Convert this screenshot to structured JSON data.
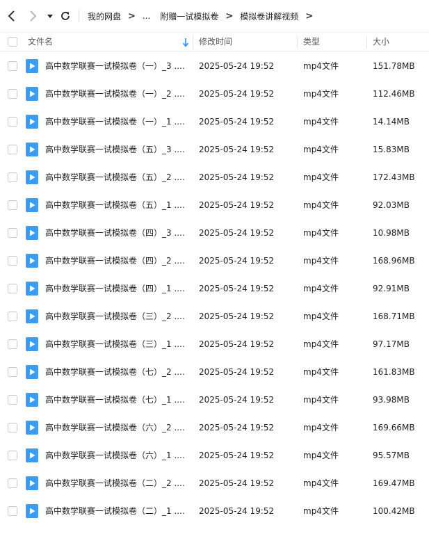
{
  "toolbar": {
    "back_icon": "chevron-left-icon",
    "forward_icon": "chevron-right-icon",
    "dropdown_icon": "caret-down-icon",
    "refresh_icon": "refresh-icon",
    "breadcrumb": [
      "我的网盘",
      "...",
      "附赠一试模拟卷",
      "模拟卷讲解视频"
    ]
  },
  "columns": {
    "name": "文件名",
    "modified": "修改时间",
    "type": "类型",
    "size": "大小"
  },
  "colors": {
    "accent": "#2c8cf4",
    "icon_blue": "#3a9cf2"
  },
  "files": [
    {
      "name": "高中数学联赛一试模拟卷（一）_3 ....",
      "modified": "2025-05-24 19:52",
      "type": "mp4文件",
      "size": "151.78MB"
    },
    {
      "name": "高中数学联赛一试模拟卷（一）_2 ....",
      "modified": "2025-05-24 19:52",
      "type": "mp4文件",
      "size": "112.46MB"
    },
    {
      "name": "高中数学联赛一试模拟卷（一）_1 ....",
      "modified": "2025-05-24 19:52",
      "type": "mp4文件",
      "size": "14.14MB"
    },
    {
      "name": "高中数学联赛一试模拟卷（五）_3 ....",
      "modified": "2025-05-24 19:52",
      "type": "mp4文件",
      "size": "15.83MB"
    },
    {
      "name": "高中数学联赛一试模拟卷（五）_2 ....",
      "modified": "2025-05-24 19:52",
      "type": "mp4文件",
      "size": "172.43MB"
    },
    {
      "name": "高中数学联赛一试模拟卷（五）_1 ....",
      "modified": "2025-05-24 19:52",
      "type": "mp4文件",
      "size": "92.03MB"
    },
    {
      "name": "高中数学联赛一试模拟卷（四）_3 ....",
      "modified": "2025-05-24 19:52",
      "type": "mp4文件",
      "size": "10.98MB"
    },
    {
      "name": "高中数学联赛一试模拟卷（四）_2 ....",
      "modified": "2025-05-24 19:52",
      "type": "mp4文件",
      "size": "168.96MB"
    },
    {
      "name": "高中数学联赛一试模拟卷（四）_1 ....",
      "modified": "2025-05-24 19:52",
      "type": "mp4文件",
      "size": "92.91MB"
    },
    {
      "name": "高中数学联赛一试模拟卷（三）_2 ....",
      "modified": "2025-05-24 19:52",
      "type": "mp4文件",
      "size": "168.71MB"
    },
    {
      "name": "高中数学联赛一试模拟卷（三）_1 ....",
      "modified": "2025-05-24 19:52",
      "type": "mp4文件",
      "size": "97.17MB"
    },
    {
      "name": "高中数学联赛一试模拟卷（七）_2 ....",
      "modified": "2025-05-24 19:52",
      "type": "mp4文件",
      "size": "161.83MB"
    },
    {
      "name": "高中数学联赛一试模拟卷（七）_1 ....",
      "modified": "2025-05-24 19:52",
      "type": "mp4文件",
      "size": "93.98MB"
    },
    {
      "name": "高中数学联赛一试模拟卷（六）_2 ....",
      "modified": "2025-05-24 19:52",
      "type": "mp4文件",
      "size": "169.66MB"
    },
    {
      "name": "高中数学联赛一试模拟卷（六）_1 ....",
      "modified": "2025-05-24 19:52",
      "type": "mp4文件",
      "size": "95.57MB"
    },
    {
      "name": "高中数学联赛一试模拟卷（二）_2 ....",
      "modified": "2025-05-24 19:52",
      "type": "mp4文件",
      "size": "169.47MB"
    },
    {
      "name": "高中数学联赛一试模拟卷（二）_1 ....",
      "modified": "2025-05-24 19:52",
      "type": "mp4文件",
      "size": "100.42MB"
    }
  ]
}
